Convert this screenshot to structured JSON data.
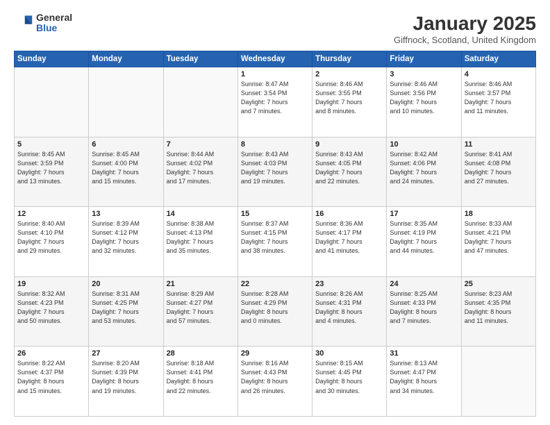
{
  "logo": {
    "general": "General",
    "blue": "Blue"
  },
  "title": "January 2025",
  "subtitle": "Giffnock, Scotland, United Kingdom",
  "days_of_week": [
    "Sunday",
    "Monday",
    "Tuesday",
    "Wednesday",
    "Thursday",
    "Friday",
    "Saturday"
  ],
  "weeks": [
    [
      {
        "day": "",
        "info": ""
      },
      {
        "day": "",
        "info": ""
      },
      {
        "day": "",
        "info": ""
      },
      {
        "day": "1",
        "info": "Sunrise: 8:47 AM\nSunset: 3:54 PM\nDaylight: 7 hours\nand 7 minutes."
      },
      {
        "day": "2",
        "info": "Sunrise: 8:46 AM\nSunset: 3:55 PM\nDaylight: 7 hours\nand 8 minutes."
      },
      {
        "day": "3",
        "info": "Sunrise: 8:46 AM\nSunset: 3:56 PM\nDaylight: 7 hours\nand 10 minutes."
      },
      {
        "day": "4",
        "info": "Sunrise: 8:46 AM\nSunset: 3:57 PM\nDaylight: 7 hours\nand 11 minutes."
      }
    ],
    [
      {
        "day": "5",
        "info": "Sunrise: 8:45 AM\nSunset: 3:59 PM\nDaylight: 7 hours\nand 13 minutes."
      },
      {
        "day": "6",
        "info": "Sunrise: 8:45 AM\nSunset: 4:00 PM\nDaylight: 7 hours\nand 15 minutes."
      },
      {
        "day": "7",
        "info": "Sunrise: 8:44 AM\nSunset: 4:02 PM\nDaylight: 7 hours\nand 17 minutes."
      },
      {
        "day": "8",
        "info": "Sunrise: 8:43 AM\nSunset: 4:03 PM\nDaylight: 7 hours\nand 19 minutes."
      },
      {
        "day": "9",
        "info": "Sunrise: 8:43 AM\nSunset: 4:05 PM\nDaylight: 7 hours\nand 22 minutes."
      },
      {
        "day": "10",
        "info": "Sunrise: 8:42 AM\nSunset: 4:06 PM\nDaylight: 7 hours\nand 24 minutes."
      },
      {
        "day": "11",
        "info": "Sunrise: 8:41 AM\nSunset: 4:08 PM\nDaylight: 7 hours\nand 27 minutes."
      }
    ],
    [
      {
        "day": "12",
        "info": "Sunrise: 8:40 AM\nSunset: 4:10 PM\nDaylight: 7 hours\nand 29 minutes."
      },
      {
        "day": "13",
        "info": "Sunrise: 8:39 AM\nSunset: 4:12 PM\nDaylight: 7 hours\nand 32 minutes."
      },
      {
        "day": "14",
        "info": "Sunrise: 8:38 AM\nSunset: 4:13 PM\nDaylight: 7 hours\nand 35 minutes."
      },
      {
        "day": "15",
        "info": "Sunrise: 8:37 AM\nSunset: 4:15 PM\nDaylight: 7 hours\nand 38 minutes."
      },
      {
        "day": "16",
        "info": "Sunrise: 8:36 AM\nSunset: 4:17 PM\nDaylight: 7 hours\nand 41 minutes."
      },
      {
        "day": "17",
        "info": "Sunrise: 8:35 AM\nSunset: 4:19 PM\nDaylight: 7 hours\nand 44 minutes."
      },
      {
        "day": "18",
        "info": "Sunrise: 8:33 AM\nSunset: 4:21 PM\nDaylight: 7 hours\nand 47 minutes."
      }
    ],
    [
      {
        "day": "19",
        "info": "Sunrise: 8:32 AM\nSunset: 4:23 PM\nDaylight: 7 hours\nand 50 minutes."
      },
      {
        "day": "20",
        "info": "Sunrise: 8:31 AM\nSunset: 4:25 PM\nDaylight: 7 hours\nand 53 minutes."
      },
      {
        "day": "21",
        "info": "Sunrise: 8:29 AM\nSunset: 4:27 PM\nDaylight: 7 hours\nand 57 minutes."
      },
      {
        "day": "22",
        "info": "Sunrise: 8:28 AM\nSunset: 4:29 PM\nDaylight: 8 hours\nand 0 minutes."
      },
      {
        "day": "23",
        "info": "Sunrise: 8:26 AM\nSunset: 4:31 PM\nDaylight: 8 hours\nand 4 minutes."
      },
      {
        "day": "24",
        "info": "Sunrise: 8:25 AM\nSunset: 4:33 PM\nDaylight: 8 hours\nand 7 minutes."
      },
      {
        "day": "25",
        "info": "Sunrise: 8:23 AM\nSunset: 4:35 PM\nDaylight: 8 hours\nand 11 minutes."
      }
    ],
    [
      {
        "day": "26",
        "info": "Sunrise: 8:22 AM\nSunset: 4:37 PM\nDaylight: 8 hours\nand 15 minutes."
      },
      {
        "day": "27",
        "info": "Sunrise: 8:20 AM\nSunset: 4:39 PM\nDaylight: 8 hours\nand 19 minutes."
      },
      {
        "day": "28",
        "info": "Sunrise: 8:18 AM\nSunset: 4:41 PM\nDaylight: 8 hours\nand 22 minutes."
      },
      {
        "day": "29",
        "info": "Sunrise: 8:16 AM\nSunset: 4:43 PM\nDaylight: 8 hours\nand 26 minutes."
      },
      {
        "day": "30",
        "info": "Sunrise: 8:15 AM\nSunset: 4:45 PM\nDaylight: 8 hours\nand 30 minutes."
      },
      {
        "day": "31",
        "info": "Sunrise: 8:13 AM\nSunset: 4:47 PM\nDaylight: 8 hours\nand 34 minutes."
      },
      {
        "day": "",
        "info": ""
      }
    ]
  ]
}
